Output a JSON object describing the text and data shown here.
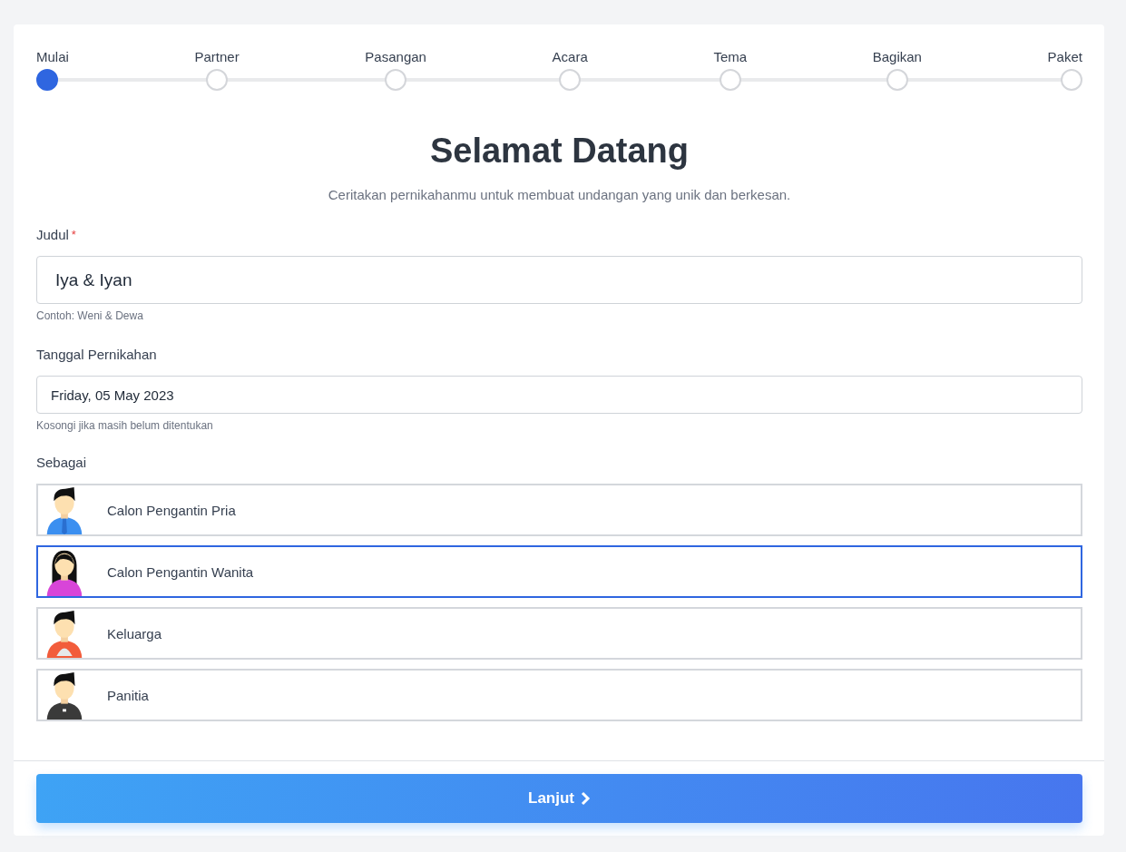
{
  "steps": [
    {
      "label": "Mulai",
      "selected": true
    },
    {
      "label": "Partner",
      "selected": false
    },
    {
      "label": "Pasangan",
      "selected": false
    },
    {
      "label": "Acara",
      "selected": false
    },
    {
      "label": "Tema",
      "selected": false
    },
    {
      "label": "Bagikan",
      "selected": false
    },
    {
      "label": "Paket",
      "selected": false
    }
  ],
  "title": "Selamat Datang",
  "subtitle": "Ceritakan pernikahanmu untuk membuat undangan yang unik dan berkesan.",
  "fields": [
    {
      "label": "Judul",
      "required_mark": "*",
      "value": "Iya & Iyan",
      "hint": "Contoh: Weni & Dewa",
      "kind": "large"
    },
    {
      "label": "Tanggal Pernikahan",
      "value": "Friday, 05 May 2023",
      "hint": "Kosongi jika masih belum ditentukan",
      "kind": "normal"
    }
  ],
  "role": {
    "label": "Sebagai",
    "options": [
      {
        "label": "Calon Pengantin Pria",
        "kind": "groom",
        "selected": false
      },
      {
        "label": "Calon Pengantin Wanita",
        "kind": "bride",
        "selected": true
      },
      {
        "label": "Keluarga",
        "kind": "family",
        "selected": false
      },
      {
        "label": "Panitia",
        "kind": "committee",
        "selected": false
      }
    ]
  },
  "next_button": "Lanjut"
}
